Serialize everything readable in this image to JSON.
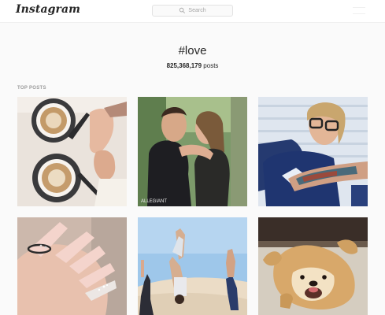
{
  "header": {
    "logo_text": "Instagram",
    "search_placeholder": "Search"
  },
  "tag": {
    "name": "#love",
    "post_count": "825,368,179",
    "post_count_unit": "posts"
  },
  "sections": {
    "top_posts_label": "TOP POSTS"
  },
  "posts": [
    {
      "subject": "two cups of coffee with hands holding"
    },
    {
      "subject": "couple embracing, watermark",
      "watermark": "ALLEGIANT"
    },
    {
      "subject": "woman with glasses and tattooed arm"
    },
    {
      "subject": "pink manicured nails"
    },
    {
      "subject": "people doing handstands on sand dunes"
    },
    {
      "subject": "golden retriever puppy on its back"
    }
  ],
  "colors": {
    "page_background": "#fafafa",
    "topbar_background": "#ffffff",
    "text_primary": "#262626",
    "text_secondary": "#999999"
  }
}
